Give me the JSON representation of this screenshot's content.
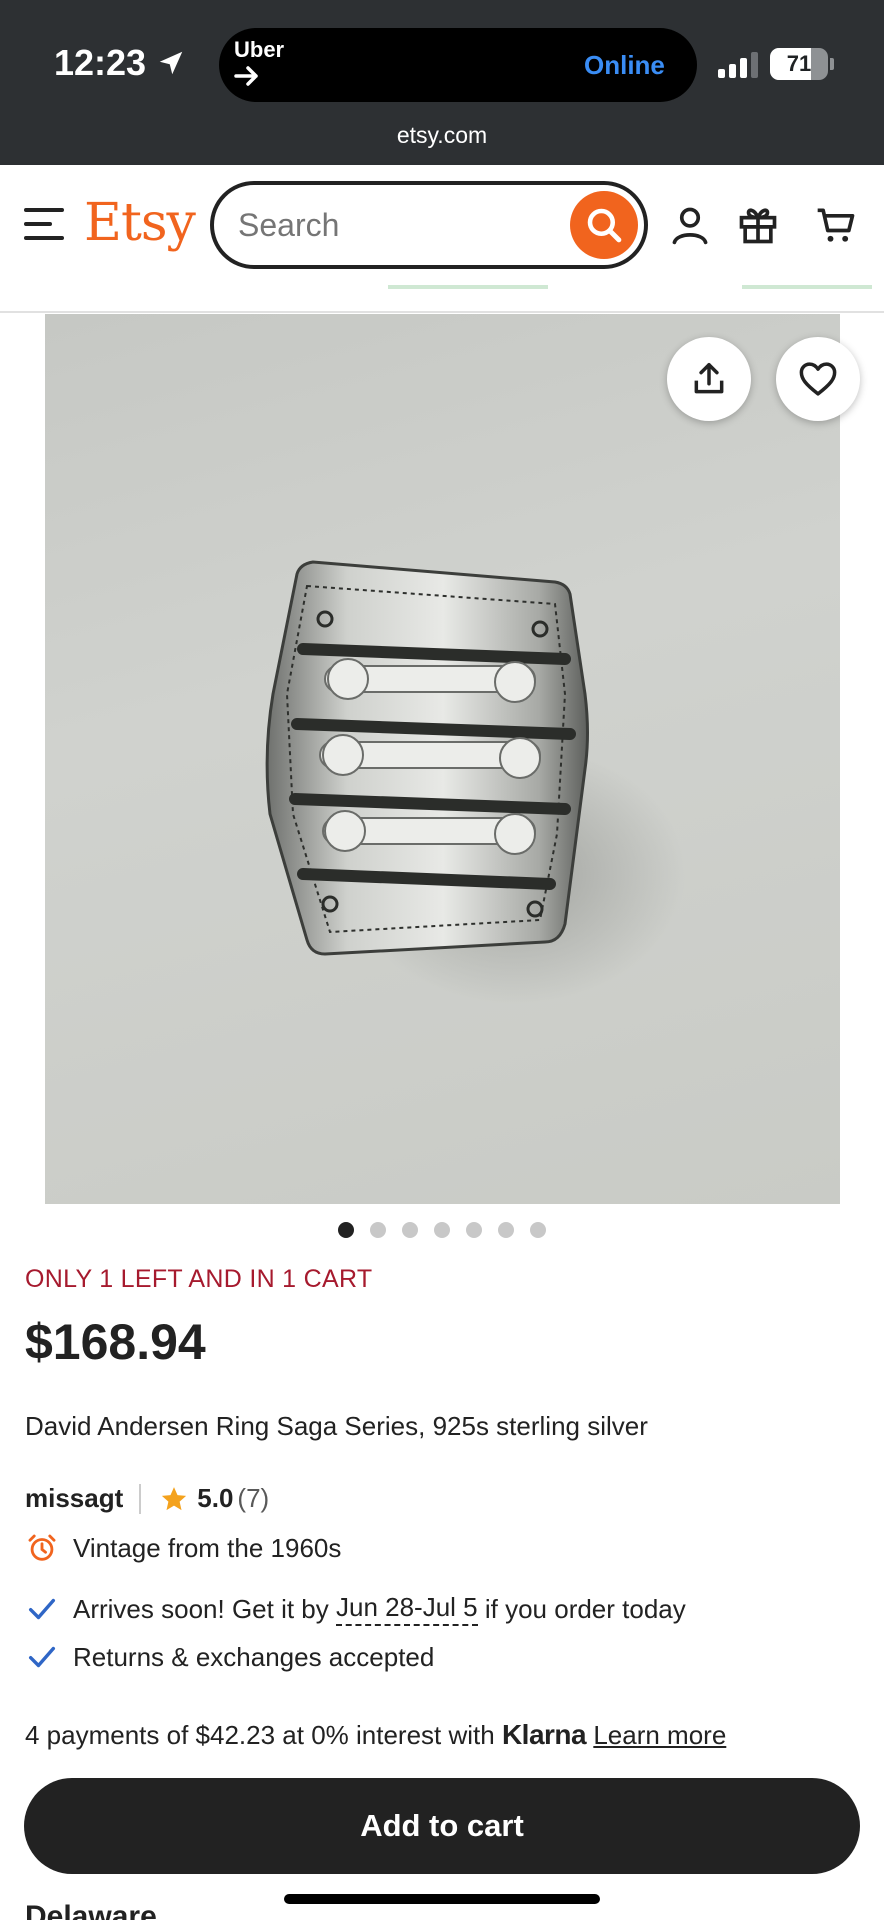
{
  "status_bar": {
    "time": "12:23",
    "island_app": "Uber",
    "island_status": "Online",
    "battery": "71",
    "url": "etsy.com"
  },
  "header": {
    "logo": "Etsy",
    "search_placeholder": "Search"
  },
  "product": {
    "image_count": 7,
    "active_image": 1,
    "stock_notice": "ONLY 1 LEFT AND IN 1 CART",
    "price": "$168.94",
    "title": "David Andersen Ring Saga Series, 925s sterling silver",
    "seller": "missagt",
    "rating": "5.0",
    "review_count": "(7)",
    "vintage": "Vintage from the 1960s",
    "arrival_prefix": "Arrives soon! Get it by ",
    "arrival_dates": "Jun 28-Jul 5",
    "arrival_suffix": " if you order today",
    "returns": "Returns & exchanges accepted"
  },
  "klarna": {
    "text": "4 payments of $42.23 at 0% interest with ",
    "brand": "Klarna",
    "learn_more": "Learn more"
  },
  "add_to_cart_label": "Add to cart",
  "next_section_partial": "Delaware...",
  "colors": {
    "brand_orange": "#f1641e",
    "stock_red": "#a61a2e",
    "check_blue": "#2f66c6",
    "button_dark": "#222222"
  }
}
